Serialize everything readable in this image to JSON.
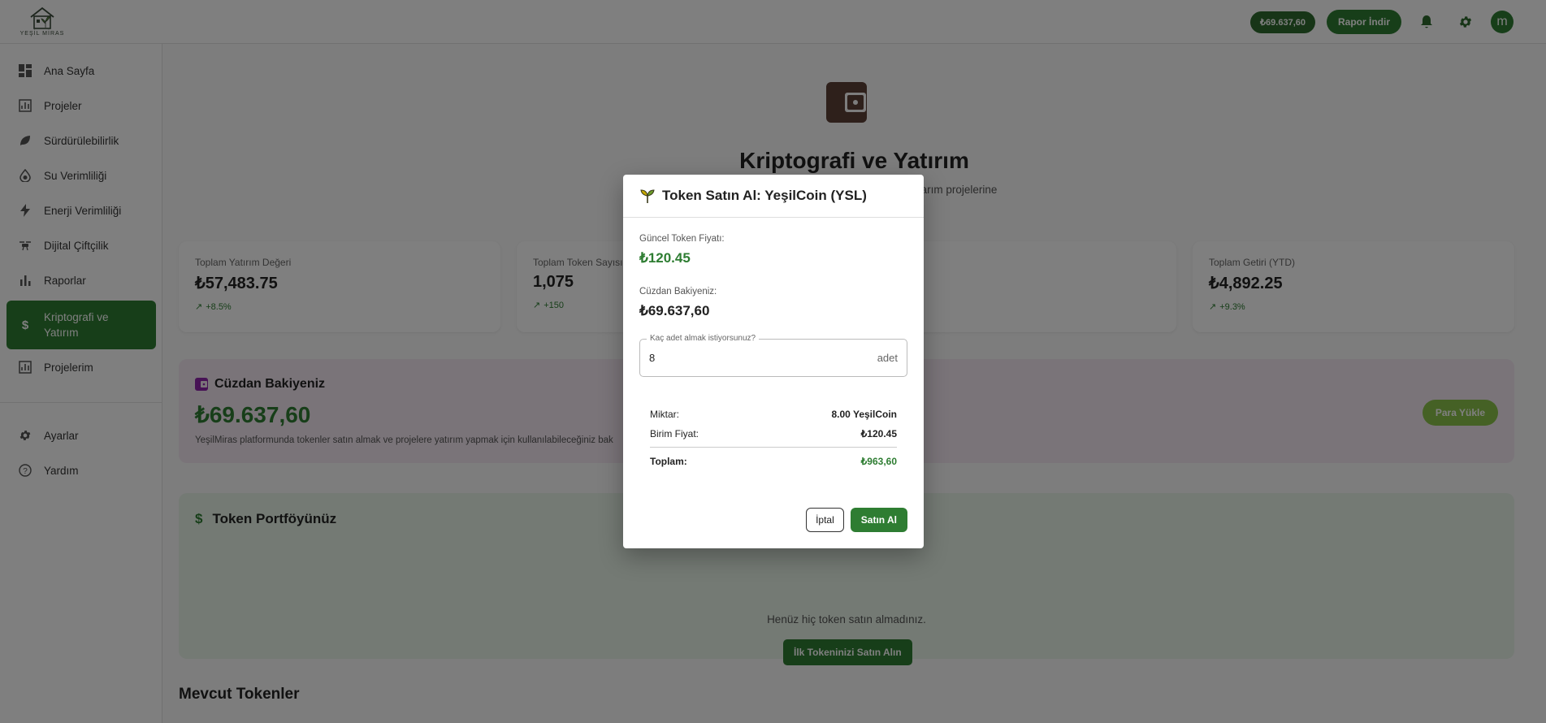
{
  "header": {
    "logo_text": "YEŞİL MİRAS",
    "balance": "₺69.637,60",
    "report_button": "Rapor İndir",
    "avatar_letter": "m"
  },
  "sidebar": {
    "items": [
      {
        "label": "Ana Sayfa",
        "icon": "dashboard-icon"
      },
      {
        "label": "Projeler",
        "icon": "chart-icon"
      },
      {
        "label": "Sürdürülebilirlik",
        "icon": "leaf-icon"
      },
      {
        "label": "Su Verimliliği",
        "icon": "water-drop-icon"
      },
      {
        "label": "Enerji Verimliliği",
        "icon": "bolt-icon"
      },
      {
        "label": "Dijital Çiftçilik",
        "icon": "drone-icon"
      },
      {
        "label": "Raporlar",
        "icon": "bar-chart-icon"
      },
      {
        "label": "Kriptografi ve Yatırım",
        "icon": "dollar-icon"
      },
      {
        "label": "Projelerim",
        "icon": "chart-icon"
      }
    ],
    "bottom_items": [
      {
        "label": "Ayarlar",
        "icon": "gear-icon"
      },
      {
        "label": "Yardım",
        "icon": "help-icon"
      }
    ]
  },
  "main": {
    "title": "Kriptografi ve Yatırım",
    "subtitle": "ürdürülebilir tarım projelerine",
    "stats": [
      {
        "label": "Toplam Yatırım Değeri",
        "value": "₺57,483.75",
        "delta": "+8.5%"
      },
      {
        "label": "Toplam Token Sayısı",
        "value": "1,075",
        "delta": "+150"
      },
      {
        "label": "Toplam Getiri (YTD)",
        "value": "₺4,892.25",
        "delta": "+9.3%"
      }
    ],
    "wallet": {
      "title": "Cüzdan Bakiyeniz",
      "amount": "₺69.637,60",
      "description": "YeşilMiras platformunda tokenler satın almak ve projelere yatırım yapmak için kullanılabileceğiniz bak",
      "topup_button": "Para Yükle"
    },
    "portfolio": {
      "title": "Token Portföyünüz",
      "empty_text": "Henüz hiç token satın almadınız.",
      "first_button": "İlk Tokeninizi Satın Alın"
    },
    "available_title": "Mevcut Tokenler"
  },
  "dialog": {
    "title": "Token Satın Al: YeşilCoin (YSL)",
    "price_label": "Güncel Token Fiyatı:",
    "price_value": "₺120.45",
    "balance_label": "Cüzdan Bakiyeniz:",
    "balance_value": "₺69.637,60",
    "qty_label": "Kaç adet almak istiyorsunuz?",
    "qty_value": "8",
    "qty_unit": "adet",
    "summary": {
      "amount_label": "Miktar:",
      "amount_value": "8.00 YeşilCoin",
      "unit_price_label": "Birim Fiyat:",
      "unit_price_value": "₺120.45",
      "total_label": "Toplam:",
      "total_value": "₺963,60"
    },
    "cancel_button": "İptal",
    "buy_button": "Satın Al"
  },
  "colors": {
    "primary": "#2e7d32",
    "accent_light": "#8bc34a",
    "wallet_bg": "#f4e9f3",
    "portfolio_bg": "#e8f5e9",
    "wallet_icon": "#5d4037"
  }
}
